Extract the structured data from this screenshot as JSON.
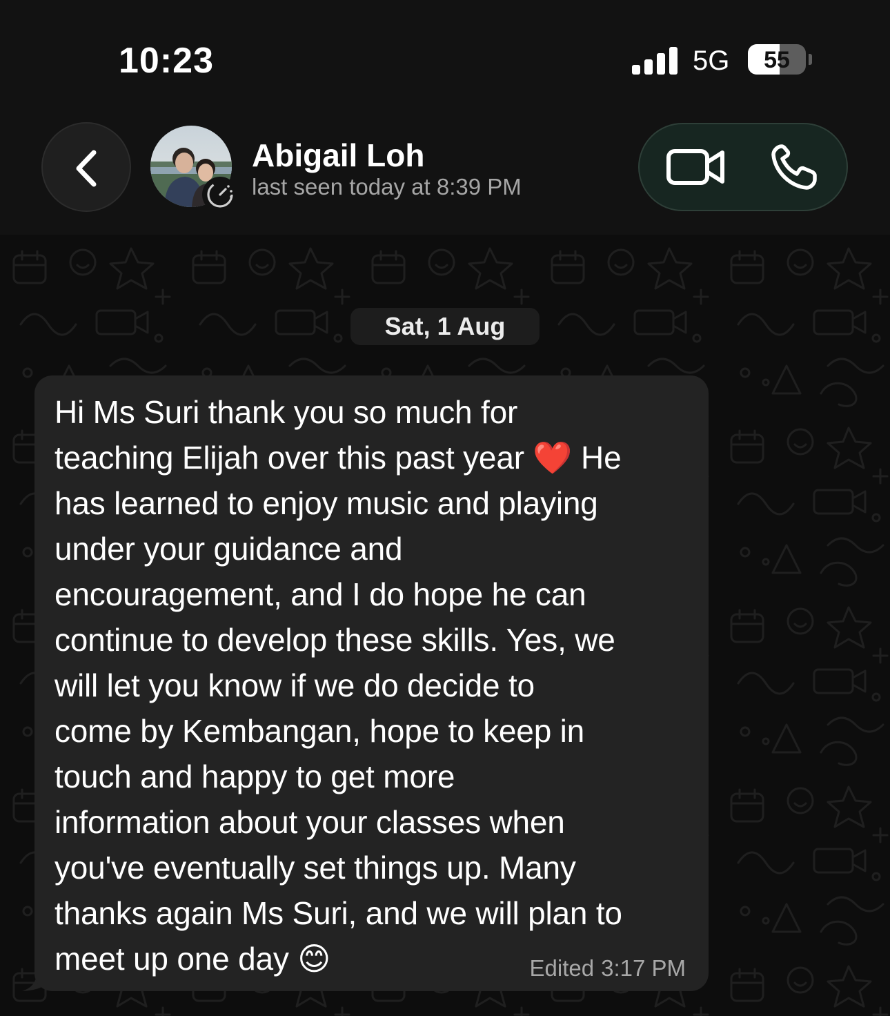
{
  "status_bar": {
    "time": "10:23",
    "network": "5G",
    "battery": "55",
    "battery_fraction": 0.55,
    "signal_icon": "cellular-signal-icon"
  },
  "header": {
    "back_icon": "chevron-left-icon",
    "contact_name": "Abigail Loh",
    "contact_status": "last seen today at 8:39 PM",
    "avatar_badge_icon": "disappearing-timer-icon",
    "video_call_icon": "video-camera-icon",
    "voice_call_icon": "phone-icon"
  },
  "chat": {
    "date_separator": "Sat, 1 Aug",
    "messages": [
      {
        "text": "Hi Ms Suri thank you so much for\nteaching Elijah over this past year ❤️ He\nhas learned to enjoy music and playing\nunder your guidance and\nencouragement, and I do hope he can\ncontinue to develop these skills. Yes, we\nwill let you know if we do decide to\ncome by Kembangan, hope to keep in\ntouch and happy to get more\ninformation about your classes when\nyou've eventually set things up. Many\nthanks again Ms Suri, and we will plan to\nmeet up one day 😊",
        "edited_label": "Edited",
        "time": "3:17 PM"
      }
    ]
  },
  "colors": {
    "background": "#0d0d0d",
    "header_background": "#121212",
    "bubble_background": "#232323",
    "call_pill_background": "#172621",
    "muted_text": "#a6a6a6"
  }
}
